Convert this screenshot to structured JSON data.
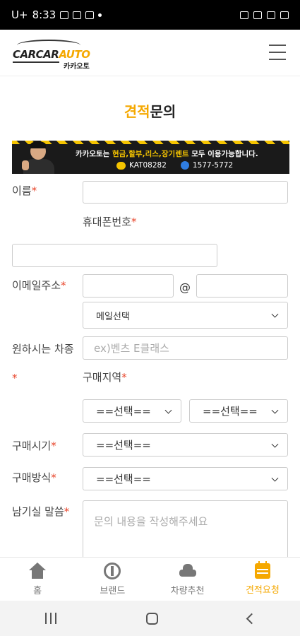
{
  "status_bar": {
    "carrier": "U+",
    "time": "8:33"
  },
  "header": {
    "logo_text_dark": "CARCAR",
    "logo_text_accent": "AUTO",
    "logo_sub": "카카오토"
  },
  "page": {
    "title_accent": "견적",
    "title_rest": "문의"
  },
  "banner": {
    "line1_pre": "카카오토는 ",
    "line1_highlight": "현금,할부,리스,장기렌트",
    "line1_post": " 모두 이용가능합니다.",
    "kakao_id": "KAT08282",
    "phone": "1577-5772"
  },
  "form": {
    "name_label": "이름",
    "phone_label": "휴대폰번호",
    "email_label": "이메일주소",
    "email_at": "@",
    "email_select": "메일선택",
    "car_label": "원하시는 차종",
    "car_placeholder": "ex)벤츠 E클래스",
    "region_label": "구매지역",
    "region_select1": "==선택==",
    "region_select2": "==선택==",
    "time_label": "구매시기",
    "time_select": "==선택==",
    "method_label": "구매방식",
    "method_select": "==선택==",
    "message_label": "남기실 말씀",
    "message_placeholder": "문의 내용을 작성해주세요",
    "required_mark": "*"
  },
  "tabs": [
    {
      "label": "홈",
      "icon": "home-icon"
    },
    {
      "label": "브랜드",
      "icon": "brand-icon"
    },
    {
      "label": "차량추천",
      "icon": "car-icon"
    },
    {
      "label": "견적요청",
      "icon": "calendar-icon"
    }
  ],
  "colors": {
    "accent": "#f5a800",
    "required": "#e8462c"
  }
}
